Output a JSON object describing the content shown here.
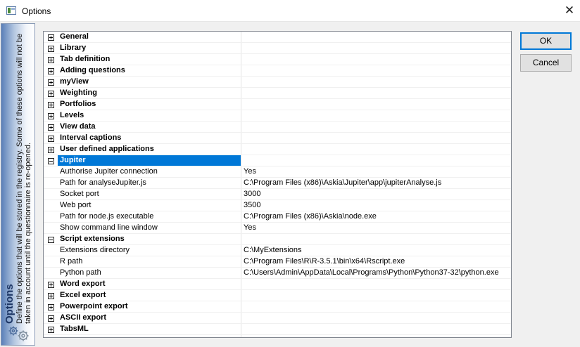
{
  "window": {
    "title": "Options",
    "close_glyph": "✕",
    "icon": "options-window-icon"
  },
  "side_panel": {
    "heading": "Options",
    "description": "Define the options that will be stored in the registry. Some of these options will not be taken in account until the questionnaire is re-opened.",
    "icon": "gear-icon"
  },
  "buttons": {
    "ok": "OK",
    "cancel": "Cancel"
  },
  "colors": {
    "selection": "#0078d7",
    "sidebar_gradient_start": "#5a7fb8"
  },
  "rows": [
    {
      "type": "category",
      "name": "General",
      "expanded": false
    },
    {
      "type": "category",
      "name": "Library",
      "expanded": false
    },
    {
      "type": "category",
      "name": "Tab definition",
      "expanded": false
    },
    {
      "type": "category",
      "name": "Adding questions",
      "expanded": false
    },
    {
      "type": "category",
      "name": "myView",
      "expanded": false
    },
    {
      "type": "category",
      "name": "Weighting",
      "expanded": false
    },
    {
      "type": "category",
      "name": "Portfolios",
      "expanded": false
    },
    {
      "type": "category",
      "name": "Levels",
      "expanded": false
    },
    {
      "type": "category",
      "name": "View data",
      "expanded": false
    },
    {
      "type": "category",
      "name": "Interval captions",
      "expanded": false
    },
    {
      "type": "category",
      "name": "User defined applications",
      "expanded": false
    },
    {
      "type": "category",
      "name": "Jupiter",
      "expanded": true,
      "selected": true
    },
    {
      "type": "property",
      "name": "Authorise Jupiter connection",
      "value": "Yes"
    },
    {
      "type": "property",
      "name": "Path for analyseJupiter.js",
      "value": "C:\\Program Files (x86)\\Askia\\Jupiter\\app\\jupiterAnalyse.js"
    },
    {
      "type": "property",
      "name": "Socket port",
      "value": "3000"
    },
    {
      "type": "property",
      "name": "Web port",
      "value": "3500"
    },
    {
      "type": "property",
      "name": "Path for node.js executable",
      "value": "C:\\Program Files (x86)\\Askia\\node.exe"
    },
    {
      "type": "property",
      "name": "Show command line window",
      "value": "Yes"
    },
    {
      "type": "category",
      "name": "Script extensions",
      "expanded": true
    },
    {
      "type": "property",
      "name": "Extensions directory",
      "value": "C:\\MyExtensions"
    },
    {
      "type": "property",
      "name": "R path",
      "value": "C:\\Program Files\\R\\R-3.5.1\\bin\\x64\\Rscript.exe"
    },
    {
      "type": "property",
      "name": "Python path",
      "value": "C:\\Users\\Admin\\AppData\\Local\\Programs\\Python\\Python37-32\\python.exe"
    },
    {
      "type": "category",
      "name": "Word export",
      "expanded": false
    },
    {
      "type": "category",
      "name": "Excel export",
      "expanded": false
    },
    {
      "type": "category",
      "name": "Powerpoint export",
      "expanded": false
    },
    {
      "type": "category",
      "name": "ASCII export",
      "expanded": false
    },
    {
      "type": "category",
      "name": "TabsML",
      "expanded": false
    }
  ]
}
